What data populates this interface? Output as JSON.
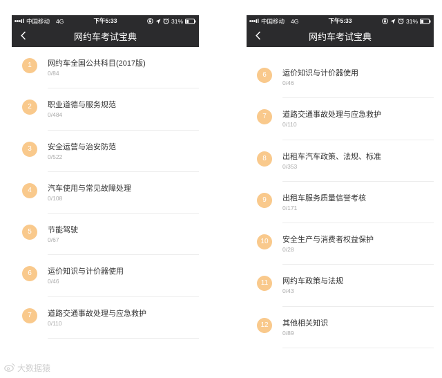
{
  "colors": {
    "nav_bg": "#2b2b2d",
    "badge_bg": "#f9c98c",
    "title_text": "#333333",
    "sub_text": "#aaaaaa",
    "divider": "#ececec",
    "watermark_text": "#cfcfcf"
  },
  "screens": [
    {
      "status_bar": {
        "carrier": "中国移动",
        "network": "4G",
        "time": "下午5:33",
        "battery": "31%",
        "battery_level": 0.31,
        "icons": [
          "signal-icon",
          "rotation-lock-icon",
          "location-icon",
          "alarm-icon",
          "battery-icon"
        ]
      },
      "nav": {
        "title": "网约车考试宝典",
        "back_icon": "chevron-left-icon"
      },
      "items": [
        {
          "num": "1",
          "title": "网约车全国公共科目(2017版)",
          "progress": "0/84"
        },
        {
          "num": "2",
          "title": "职业道德与服务规范",
          "progress": "0/484"
        },
        {
          "num": "3",
          "title": "安全运营与治安防范",
          "progress": "0/522"
        },
        {
          "num": "4",
          "title": "汽车使用与常见故障处理",
          "progress": "0/108"
        },
        {
          "num": "5",
          "title": "节能驾驶",
          "progress": "0/67"
        },
        {
          "num": "6",
          "title": "运价知识与计价器使用",
          "progress": "0/46"
        },
        {
          "num": "7",
          "title": "道路交通事故处理与应急救护",
          "progress": "0/110"
        }
      ]
    },
    {
      "status_bar": {
        "carrier": "中国移动",
        "network": "4G",
        "time": "下午5:33",
        "battery": "31%",
        "battery_level": 0.31,
        "icons": [
          "signal-icon",
          "rotation-lock-icon",
          "location-icon",
          "alarm-icon",
          "battery-icon"
        ]
      },
      "nav": {
        "title": "网约车考试宝典",
        "back_icon": "chevron-left-icon"
      },
      "items": [
        {
          "num": "6",
          "title": "运价知识与计价器使用",
          "progress": "0/46"
        },
        {
          "num": "7",
          "title": "道路交通事故处理与应急救护",
          "progress": "0/110"
        },
        {
          "num": "8",
          "title": "出租车汽车政策、法规、标准",
          "progress": "0/353"
        },
        {
          "num": "9",
          "title": "出租车服务质量信誉考核",
          "progress": "0/171"
        },
        {
          "num": "10",
          "title": "安全生产与消费者权益保护",
          "progress": "0/28"
        },
        {
          "num": "11",
          "title": "网约车政策与法规",
          "progress": "0/43"
        },
        {
          "num": "12",
          "title": "其他相关知识",
          "progress": "0/89"
        }
      ]
    }
  ],
  "watermark": {
    "text": "大数据猿",
    "icon": "weibo-icon"
  }
}
